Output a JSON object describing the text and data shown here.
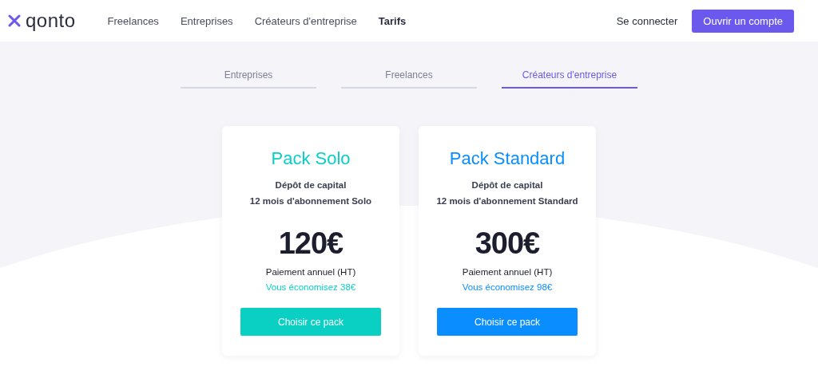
{
  "header": {
    "logo": "qonto",
    "nav": [
      {
        "label": "Freelances",
        "bold": false
      },
      {
        "label": "Entreprises",
        "bold": false
      },
      {
        "label": "Créateurs d'entreprise",
        "bold": false
      },
      {
        "label": "Tarifs",
        "bold": true
      }
    ],
    "login": "Se connecter",
    "cta": "Ouvrir un compte"
  },
  "tabs": [
    {
      "label": "Entreprises",
      "selected": false
    },
    {
      "label": "Freelances",
      "selected": false
    },
    {
      "label": "Créateurs d'entreprise",
      "selected": true
    }
  ],
  "packs": [
    {
      "title": "Pack Solo",
      "color": "#0acfc3",
      "features": [
        "Dépôt de capital",
        "12 mois d'abonnement Solo"
      ],
      "price": "120€",
      "period": "Paiement annuel (HT)",
      "saving": "Vous économisez 38€",
      "button": "Choisir ce pack"
    },
    {
      "title": "Pack Standard",
      "color": "#0a8dff",
      "features": [
        "Dépôt de capital",
        "12 mois d'abonnement Standard"
      ],
      "price": "300€",
      "period": "Paiement annuel (HT)",
      "saving": "Vous économisez 98€",
      "button": "Choisir ce pack"
    }
  ]
}
